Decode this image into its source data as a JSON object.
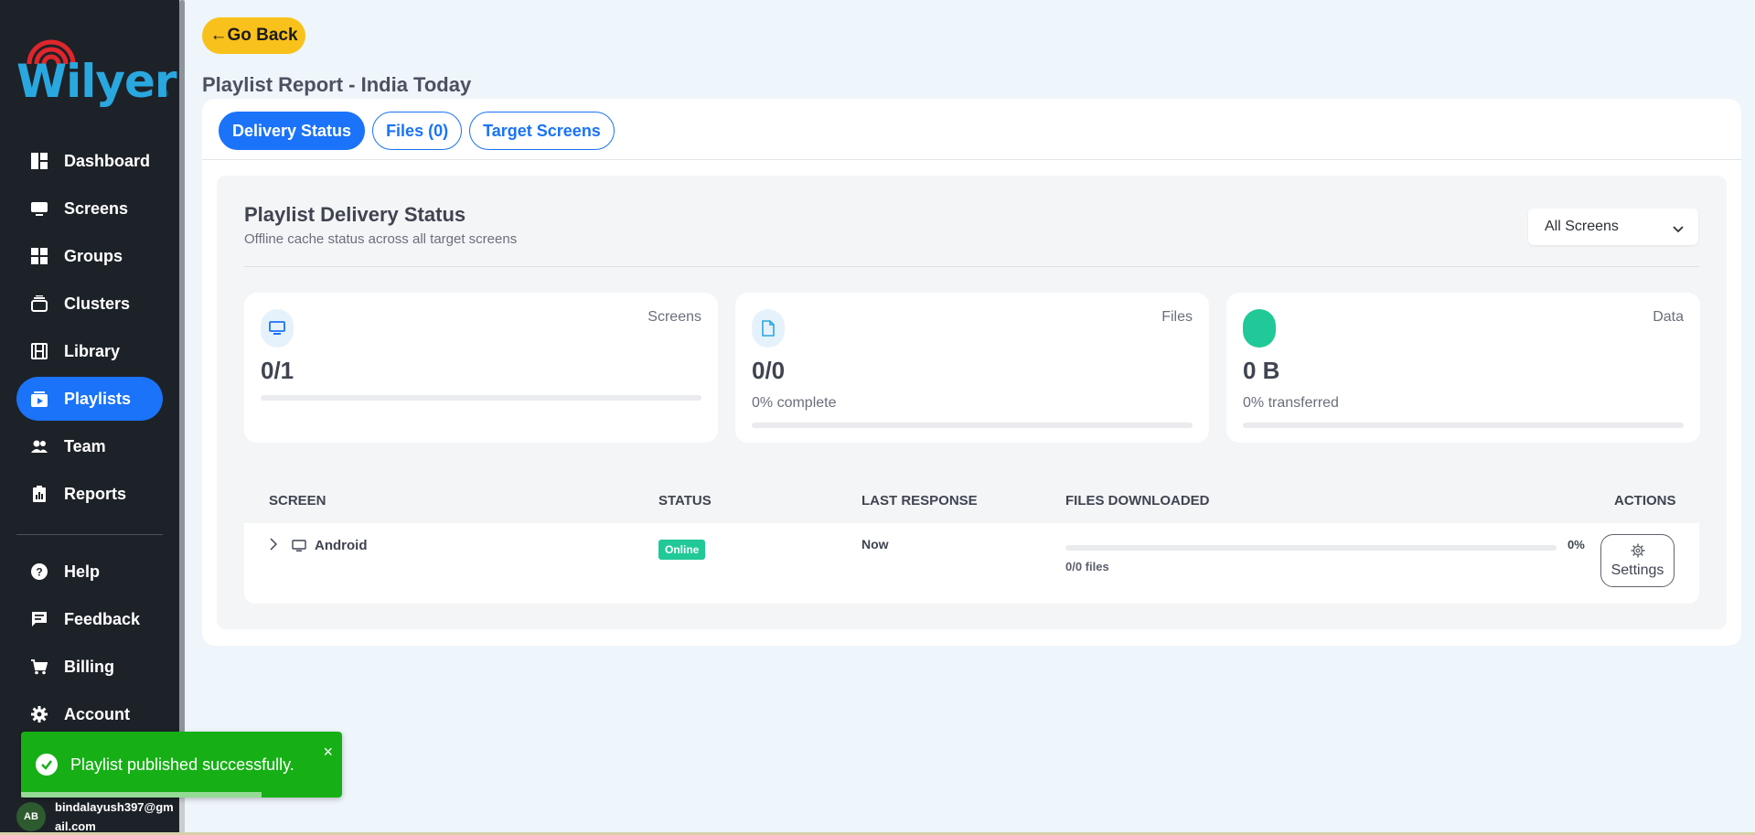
{
  "brand": {
    "name": "Wilyer",
    "reg_mark": "®"
  },
  "sidebar": {
    "items": [
      {
        "label": "Dashboard",
        "icon": "dashboard-icon"
      },
      {
        "label": "Screens",
        "icon": "monitor-icon"
      },
      {
        "label": "Groups",
        "icon": "grid-icon"
      },
      {
        "label": "Clusters",
        "icon": "layers-icon"
      },
      {
        "label": "Library",
        "icon": "film-icon"
      },
      {
        "label": "Playlists",
        "icon": "playlist-icon",
        "active": true
      },
      {
        "label": "Team",
        "icon": "team-icon"
      },
      {
        "label": "Reports",
        "icon": "report-icon"
      }
    ],
    "secondary": [
      {
        "label": "Help",
        "icon": "help-icon"
      },
      {
        "label": "Feedback",
        "icon": "feedback-icon"
      },
      {
        "label": "Billing",
        "icon": "cart-icon"
      },
      {
        "label": "Account",
        "icon": "gear-icon"
      }
    ],
    "user": {
      "initials": "AB",
      "email": "bindalayush397@gmail.com"
    }
  },
  "toast": {
    "message": "Playlist published successfully.",
    "close": "×",
    "color": "#16b016",
    "progress": 0.75
  },
  "header": {
    "back_label": "Go Back",
    "back_arrow": "←",
    "title": "Playlist Report - India Today"
  },
  "tabs": [
    {
      "label": "Delivery Status",
      "active": true
    },
    {
      "label": "Files (0)"
    },
    {
      "label": "Target Screens"
    }
  ],
  "panel": {
    "title": "Playlist Delivery Status",
    "subtitle": "Offline cache status across all target screens",
    "filter": {
      "selected": "All Screens"
    }
  },
  "stats": [
    {
      "label": "Screens",
      "value": "0/1",
      "sub": "",
      "icon": "monitor-icon",
      "progress": 0
    },
    {
      "label": "Files",
      "value": "0/0",
      "sub": "0% complete",
      "icon": "file-icon",
      "progress": 0
    },
    {
      "label": "Data",
      "value": "0 B",
      "sub": "0% transferred",
      "icon": "data-icon",
      "progress": 0
    }
  ],
  "table": {
    "headers": [
      "SCREEN",
      "STATUS",
      "LAST RESPONSE",
      "FILES DOWNLOADED",
      "ACTIONS"
    ],
    "rows": [
      {
        "screen": "Android",
        "status": "Online",
        "last_response": "Now",
        "percent": "0%",
        "files": "0/0 files",
        "progress": 0,
        "action": "Settings"
      }
    ]
  },
  "colors": {
    "accent": "#1a73f8",
    "sidebar": "#1d2228",
    "go_back": "#f9c11b",
    "online": "#20c997"
  }
}
